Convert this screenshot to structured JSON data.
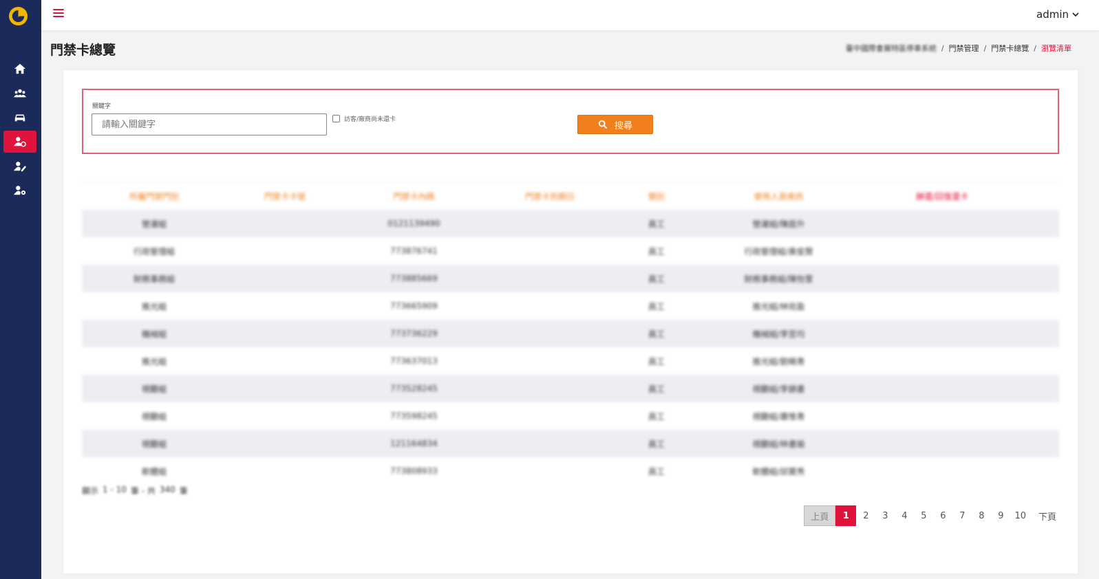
{
  "user": {
    "name": "admin"
  },
  "page": {
    "title": "門禁卡總覽"
  },
  "breadcrumb": {
    "root": "臺中國際會展特區停車系統",
    "level1": "門禁管理",
    "level2": "門禁卡總覽",
    "current": "瀏覽清單"
  },
  "search": {
    "keyword_label": "關鍵字",
    "keyword_placeholder": "請輸入關鍵字",
    "checkbox_label": "訪客/廠商尚未還卡",
    "button_label": "搜尋"
  },
  "table": {
    "headers": [
      "所屬門禁門別",
      "門禁卡卡號",
      "門禁卡內碼",
      "門禁卡到期日",
      "類別",
      "使用人員資訊",
      "歸還/回復還卡"
    ],
    "rows": [
      [
        "營運組",
        "",
        "0121139490",
        "",
        "員工",
        "營運組/陳庭升"
      ],
      [
        "行政管理組",
        "",
        "773876741",
        "",
        "員工",
        "行政管理組/黃俊賢"
      ],
      [
        "財務事務組",
        "",
        "773885669",
        "",
        "員工",
        "財務事務組/陳怡萱"
      ],
      [
        "推光組",
        "",
        "773665909",
        "",
        "員工",
        "推光組/林宛盈"
      ],
      [
        "機械組",
        "",
        "773736229",
        "",
        "員工",
        "機械組/李昱均"
      ],
      [
        "推光組",
        "",
        "773637013",
        "",
        "員工",
        "推光組/劉曉青"
      ],
      [
        "視聽組",
        "",
        "773528245",
        "",
        "員工",
        "視聽組/李錦書"
      ],
      [
        "視聽組",
        "",
        "773598245",
        "",
        "員工",
        "視聽組/蕭惟青"
      ],
      [
        "視聽組",
        "",
        "121164834",
        "",
        "員工",
        "視聽組/林書瑜"
      ],
      [
        "軟體組",
        "",
        "773808933",
        "",
        "員工",
        "軟體組/邱寶秀"
      ]
    ]
  },
  "summary": {
    "prefix": "顯示",
    "range": "1 - 10",
    "mid": "筆 - 共",
    "total": "340",
    "suffix": "筆"
  },
  "pagination": {
    "prev": "上頁",
    "next": "下頁",
    "pages": [
      "1",
      "2",
      "3",
      "4",
      "5",
      "6",
      "7",
      "8",
      "9",
      "10"
    ],
    "current": "1"
  },
  "colors": {
    "sidebar": "#1b2a59",
    "accent_red": "#e0133c",
    "accent_orange": "#f07f1c"
  },
  "sidebar": {
    "items": [
      {
        "icon": "home-icon"
      },
      {
        "icon": "users-icon"
      },
      {
        "icon": "car-icon"
      },
      {
        "icon": "user-card-icon",
        "active": true
      },
      {
        "icon": "user-edit-icon"
      },
      {
        "icon": "user-settings-icon"
      }
    ]
  }
}
